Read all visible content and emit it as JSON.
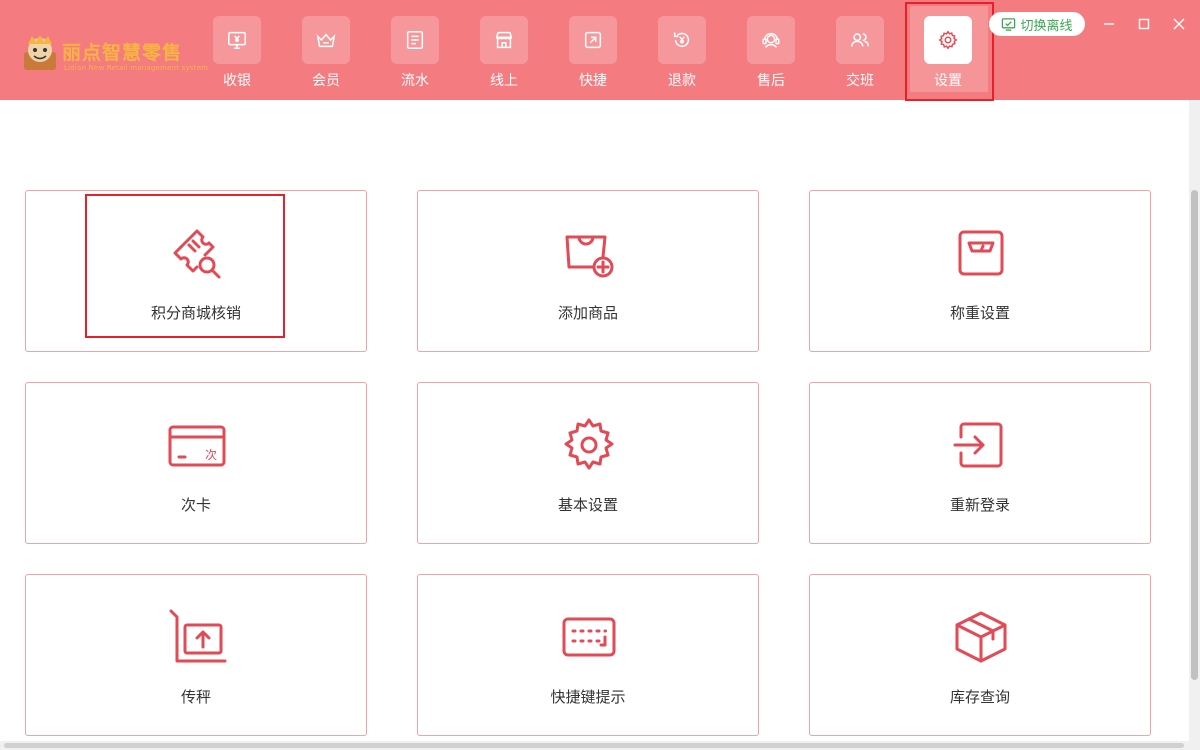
{
  "app": {
    "brand": "丽点智慧零售",
    "brand_sub": "Lidian New Retail management system"
  },
  "nav": {
    "items": [
      {
        "label": "收银",
        "icon": "monitor-yen-icon"
      },
      {
        "label": "会员",
        "icon": "crown-icon"
      },
      {
        "label": "流水",
        "icon": "ledger-icon"
      },
      {
        "label": "线上",
        "icon": "storefront-icon"
      },
      {
        "label": "快捷",
        "icon": "quick-icon"
      },
      {
        "label": "退款",
        "icon": "refund-icon"
      },
      {
        "label": "售后",
        "icon": "headset-icon"
      },
      {
        "label": "交班",
        "icon": "users-icon"
      },
      {
        "label": "设置",
        "icon": "gear-icon",
        "active": true
      }
    ]
  },
  "header": {
    "offline_label": "切换离线"
  },
  "cards": [
    {
      "label": "积分商城核销",
      "icon": "ticket-search-icon"
    },
    {
      "label": "添加商品",
      "icon": "bag-add-icon"
    },
    {
      "label": "称重设置",
      "icon": "scale-icon"
    },
    {
      "label": "次卡",
      "icon": "card-icon",
      "badge": "次"
    },
    {
      "label": "基本设置",
      "icon": "gear-icon"
    },
    {
      "label": "重新登录",
      "icon": "login-icon"
    },
    {
      "label": "传秤",
      "icon": "scale-upload-icon"
    },
    {
      "label": "快捷键提示",
      "icon": "keyboard-icon"
    },
    {
      "label": "库存查询",
      "icon": "box-icon"
    }
  ],
  "colors": {
    "header_bg": "#f47b7f",
    "accent": "#e24a55",
    "highlight": "#e8202a",
    "offline_green": "#3aa852"
  }
}
